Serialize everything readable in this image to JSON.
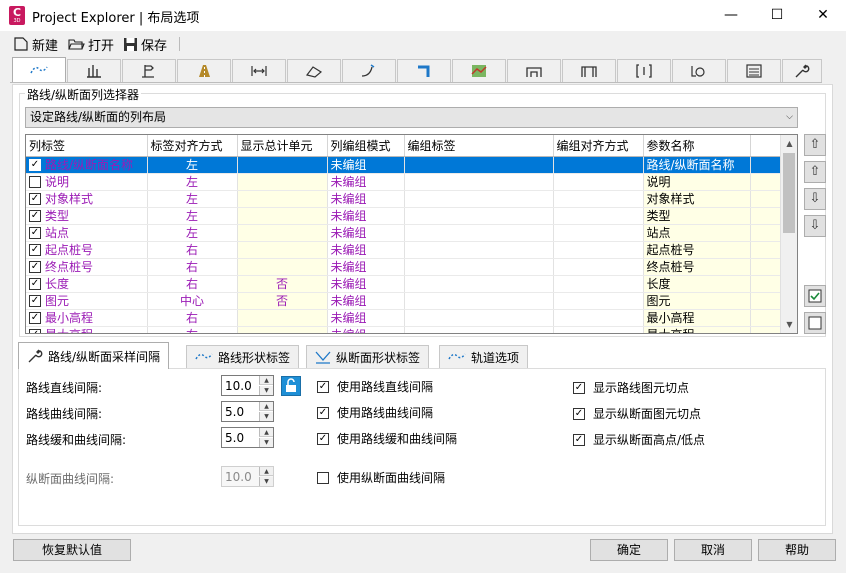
{
  "window": {
    "title": "Project Explorer | 布局选项",
    "app_icon_letter": "C",
    "app_icon_sub": "3D",
    "controls": {
      "minimize": "—",
      "maximize": "☐",
      "close": "✕"
    }
  },
  "toolbar": {
    "new_label": "新建",
    "open_label": "打开",
    "save_label": "保存"
  },
  "top_tabs": [
    "alignment-profile-icon",
    "bars-icon",
    "signpost-icon",
    "road-icon",
    "width-icon",
    "surface-icon",
    "curve-icon",
    "corridor-icon",
    "map-icon",
    "structure-icon",
    "structure2-icon",
    "bracket-icon",
    "target-icon",
    "list-icon",
    "wrench-icon"
  ],
  "selector": {
    "group_label": "路线/纵断面列选择器",
    "dropdown_value": "设定路线/纵断面的列布局"
  },
  "grid": {
    "columns": [
      "列标签",
      "标签对齐方式",
      "显示总计单元",
      "列编组模式",
      "编组标签",
      "编组对齐方式",
      "参数名称"
    ],
    "rows": [
      {
        "checked": true,
        "label": "路线/纵断面名称",
        "align": "左",
        "total": "",
        "group_mode": "未编组",
        "group_label": "",
        "group_align": "",
        "param": "路线/纵断面名称",
        "selected": true
      },
      {
        "checked": false,
        "label": "说明",
        "align": "左",
        "total": "",
        "group_mode": "未编组",
        "group_label": "",
        "group_align": "",
        "param": "说明"
      },
      {
        "checked": true,
        "label": "对象样式",
        "align": "左",
        "total": "",
        "group_mode": "未编组",
        "group_label": "",
        "group_align": "",
        "param": "对象样式"
      },
      {
        "checked": true,
        "label": "类型",
        "align": "左",
        "total": "",
        "group_mode": "未编组",
        "group_label": "",
        "group_align": "",
        "param": "类型"
      },
      {
        "checked": true,
        "label": "站点",
        "align": "左",
        "total": "",
        "group_mode": "未编组",
        "group_label": "",
        "group_align": "",
        "param": "站点"
      },
      {
        "checked": true,
        "label": "起点桩号",
        "align": "右",
        "total": "",
        "group_mode": "未编组",
        "group_label": "",
        "group_align": "",
        "param": "起点桩号"
      },
      {
        "checked": true,
        "label": "终点桩号",
        "align": "右",
        "total": "",
        "group_mode": "未编组",
        "group_label": "",
        "group_align": "",
        "param": "终点桩号"
      },
      {
        "checked": true,
        "label": "长度",
        "align": "右",
        "total": "否",
        "group_mode": "未编组",
        "group_label": "",
        "group_align": "",
        "param": "长度"
      },
      {
        "checked": true,
        "label": "图元",
        "align": "中心",
        "total": "否",
        "group_mode": "未编组",
        "group_label": "",
        "group_align": "",
        "param": "图元"
      },
      {
        "checked": true,
        "label": "最小高程",
        "align": "右",
        "total": "",
        "group_mode": "未编组",
        "group_label": "",
        "group_align": "",
        "param": "最小高程"
      },
      {
        "checked": true,
        "label": "最大高程",
        "align": "右",
        "total": "",
        "group_mode": "未编组",
        "group_label": "",
        "group_align": "",
        "param": "最大高程"
      }
    ]
  },
  "bottom_tabs": [
    {
      "label": "路线/纵断面采样间隔",
      "icon": "wrench-icon",
      "active": true
    },
    {
      "label": "路线形状标签",
      "icon": "dashed-curve-icon",
      "active": false
    },
    {
      "label": "纵断面形状标签",
      "icon": "profile-shape-icon",
      "active": false
    },
    {
      "label": "轨道选项",
      "icon": "rail-icon",
      "active": false
    }
  ],
  "sampling": {
    "line_interval_label": "路线直线间隔:",
    "line_interval_value": "10.0",
    "curve_interval_label": "路线曲线间隔:",
    "curve_interval_value": "5.0",
    "spiral_interval_label": "路线缓和曲线间隔:",
    "spiral_interval_value": "5.0",
    "profile_curve_label": "纵断面曲线间隔:",
    "profile_curve_value": "10.0",
    "use_line": "使用路线直线间隔",
    "use_curve": "使用路线曲线间隔",
    "use_spiral": "使用路线缓和曲线间隔",
    "use_profile_curve": "使用纵断面曲线间隔",
    "show_align_tangent": "显示路线图元切点",
    "show_profile_tangent": "显示纵断面图元切点",
    "show_profile_highlow": "显示纵断面高点/低点"
  },
  "footer": {
    "restore_label": "恢复默认值",
    "ok_label": "确定",
    "cancel_label": "取消",
    "help_label": "帮助"
  }
}
